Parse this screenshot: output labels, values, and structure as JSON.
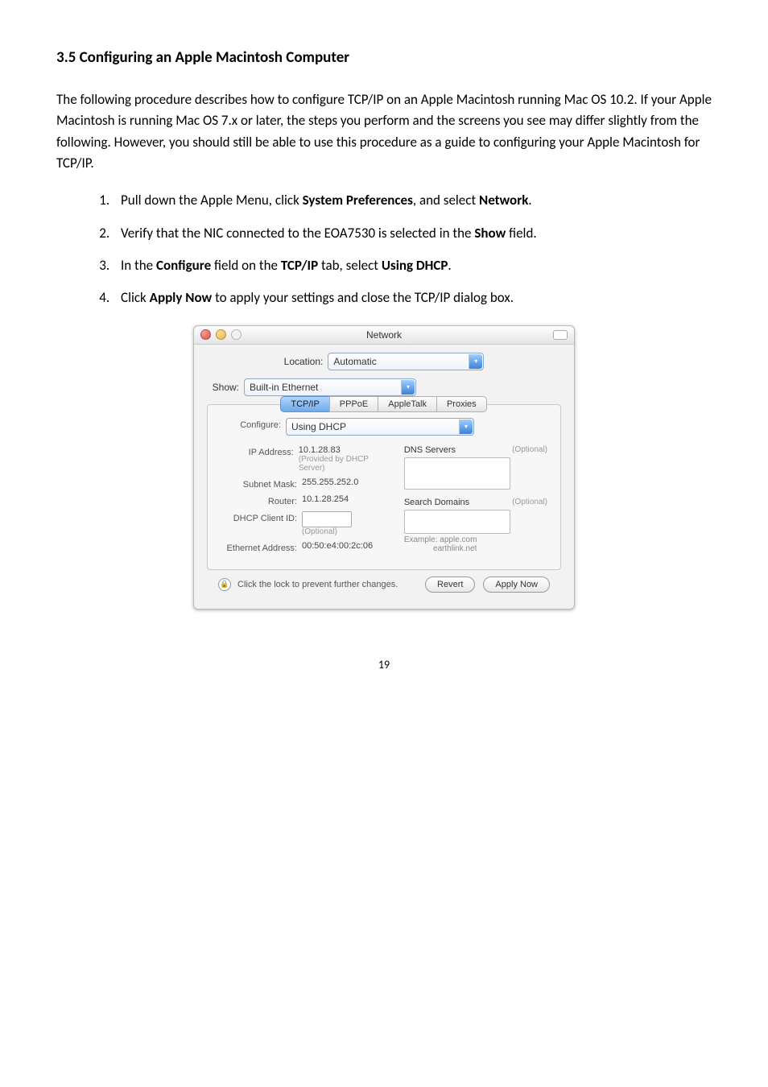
{
  "heading": "3.5 Configuring an Apple Macintosh Computer",
  "intro": "The following procedure describes how to configure TCP/IP on an Apple Macintosh running Mac OS 10.2. If your Apple Macintosh is running Mac OS 7.x or later, the steps you perform and the screens you see may differ slightly from the following. However, you should still be able to use this procedure as a guide to configuring your Apple Macintosh for TCP/IP.",
  "steps": {
    "s1_a": "Pull down the Apple Menu, click ",
    "s1_b": "System Preferences",
    "s1_c": ", and select ",
    "s1_d": "Network",
    "s1_e": ".",
    "s2_a": "Verify that the NIC connected to the EOA7530 is selected in the ",
    "s2_b": "Show",
    "s2_c": " field.",
    "s3_a": "In the ",
    "s3_b": "Configure",
    "s3_c": " field on the ",
    "s3_d": "TCP/IP",
    "s3_e": " tab, select ",
    "s3_f": "Using DHCP",
    "s3_g": ".",
    "s4_a": "Click ",
    "s4_b": "Apply Now",
    "s4_c": " to apply your settings and close the TCP/IP dialog box."
  },
  "page_number": "19",
  "dialog": {
    "title": "Network",
    "location_label": "Location:",
    "location_value": "Automatic",
    "show_label": "Show:",
    "show_value": "Built-in Ethernet",
    "tabs": {
      "tcpip": "TCP/IP",
      "pppoe": "PPPoE",
      "appletalk": "AppleTalk",
      "proxies": "Proxies"
    },
    "configure_label": "Configure:",
    "configure_value": "Using DHCP",
    "dns_label": "DNS Servers",
    "optional": "(Optional)",
    "ip_label": "IP Address:",
    "ip_value": "10.1.28.83",
    "ip_sub": "(Provided by DHCP Server)",
    "subnet_label": "Subnet Mask:",
    "subnet_value": "255.255.252.0",
    "router_label": "Router:",
    "router_value": "10.1.28.254",
    "search_label": "Search Domains",
    "dhcp_client_label": "DHCP Client ID:",
    "dhcp_client_sub": "(Optional)",
    "eth_label": "Ethernet Address:",
    "eth_value": "00:50:e4:00:2c:06",
    "example_label": "Example:",
    "example_val1": "apple.com",
    "example_val2": "earthlink.net",
    "lock_text": "Click the lock to prevent further changes.",
    "revert_btn": "Revert",
    "apply_btn": "Apply Now"
  }
}
